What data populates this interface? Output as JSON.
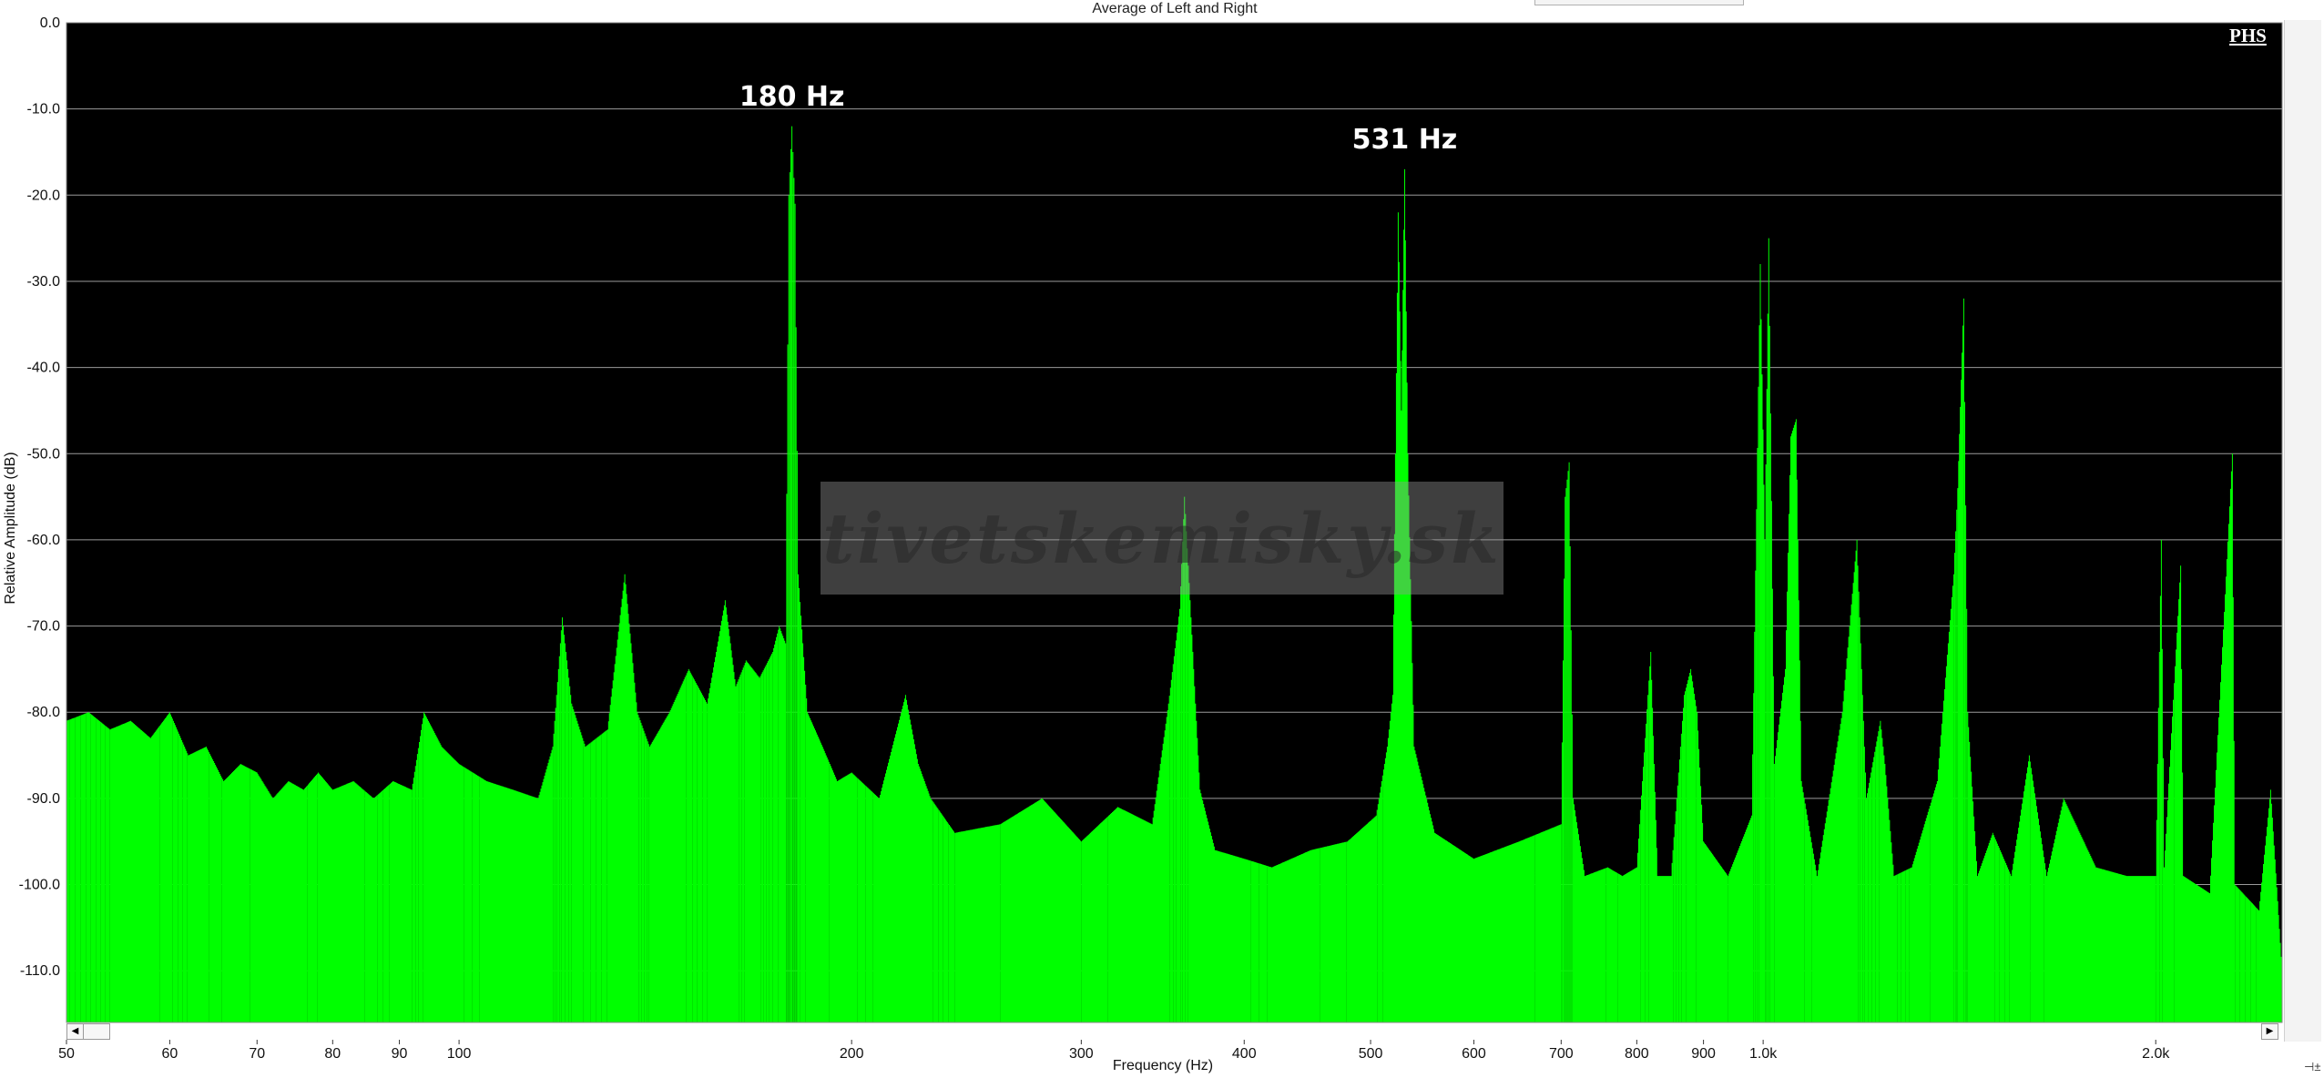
{
  "chart_data": {
    "type": "area",
    "title": "Average of Left and Right",
    "xlabel": "Frequency (Hz)",
    "ylabel": "Relative Amplitude (dB)",
    "x_scale": "log",
    "xlim": [
      50,
      2500
    ],
    "ylim": [
      -116,
      0
    ],
    "grid": "horizontal",
    "x_ticks": [
      "50",
      "60",
      "70",
      "80",
      "90",
      "100",
      "200",
      "300",
      "400",
      "500",
      "600",
      "700",
      "800",
      "900",
      "1.0k",
      "2.0k"
    ],
    "x_tick_values": [
      50,
      60,
      70,
      80,
      90,
      100,
      200,
      300,
      400,
      500,
      600,
      700,
      800,
      900,
      1000,
      2000
    ],
    "y_ticks": [
      "0.0",
      "-10.0",
      "-20.0",
      "-30.0",
      "-40.0",
      "-50.0",
      "-60.0",
      "-70.0",
      "-80.0",
      "-90.0",
      "-100.0",
      "-110.0"
    ],
    "y_tick_values": [
      0,
      -10,
      -20,
      -30,
      -40,
      -50,
      -60,
      -70,
      -80,
      -90,
      -100,
      -110
    ],
    "series": [
      {
        "color": "#00ff00",
        "floor_db": -116,
        "points": [
          [
            50,
            -81
          ],
          [
            52,
            -80
          ],
          [
            54,
            -82
          ],
          [
            56,
            -81
          ],
          [
            58,
            -83
          ],
          [
            60,
            -80
          ],
          [
            62,
            -85
          ],
          [
            64,
            -84
          ],
          [
            66,
            -88
          ],
          [
            68,
            -86
          ],
          [
            70,
            -87
          ],
          [
            72,
            -90
          ],
          [
            74,
            -88
          ],
          [
            76,
            -89
          ],
          [
            78,
            -87
          ],
          [
            80,
            -89
          ],
          [
            83,
            -88
          ],
          [
            86,
            -90
          ],
          [
            89,
            -88
          ],
          [
            92,
            -89
          ],
          [
            94,
            -80
          ],
          [
            97,
            -84
          ],
          [
            100,
            -86
          ],
          [
            105,
            -88
          ],
          [
            110,
            -89
          ],
          [
            115,
            -90
          ],
          [
            118,
            -84
          ],
          [
            120,
            -69
          ],
          [
            122,
            -79
          ],
          [
            125,
            -84
          ],
          [
            130,
            -82
          ],
          [
            134,
            -64
          ],
          [
            137,
            -80
          ],
          [
            140,
            -84
          ],
          [
            145,
            -80
          ],
          [
            150,
            -75
          ],
          [
            155,
            -79
          ],
          [
            160,
            -67
          ],
          [
            163,
            -77
          ],
          [
            166,
            -74
          ],
          [
            170,
            -76
          ],
          [
            174,
            -73
          ],
          [
            176,
            -70
          ],
          [
            178,
            -72
          ],
          [
            179,
            -20
          ],
          [
            180,
            -12
          ],
          [
            181,
            -21
          ],
          [
            182,
            -64
          ],
          [
            185,
            -80
          ],
          [
            190,
            -84
          ],
          [
            195,
            -88
          ],
          [
            200,
            -87
          ],
          [
            210,
            -90
          ],
          [
            220,
            -78
          ],
          [
            225,
            -86
          ],
          [
            230,
            -90
          ],
          [
            240,
            -94
          ],
          [
            260,
            -93
          ],
          [
            280,
            -90
          ],
          [
            300,
            -95
          ],
          [
            320,
            -91
          ],
          [
            340,
            -93
          ],
          [
            350,
            -79
          ],
          [
            357,
            -68
          ],
          [
            360,
            -55
          ],
          [
            363,
            -65
          ],
          [
            370,
            -89
          ],
          [
            380,
            -96
          ],
          [
            400,
            -97
          ],
          [
            420,
            -98
          ],
          [
            450,
            -96
          ],
          [
            480,
            -95
          ],
          [
            505,
            -92
          ],
          [
            515,
            -84
          ],
          [
            520,
            -78
          ],
          [
            525,
            -22
          ],
          [
            528,
            -45
          ],
          [
            531,
            -17
          ],
          [
            534,
            -50
          ],
          [
            540,
            -84
          ],
          [
            560,
            -94
          ],
          [
            600,
            -97
          ],
          [
            650,
            -95
          ],
          [
            700,
            -93
          ],
          [
            705,
            -55
          ],
          [
            710,
            -51
          ],
          [
            715,
            -90
          ],
          [
            730,
            -99
          ],
          [
            760,
            -98
          ],
          [
            780,
            -99
          ],
          [
            800,
            -98
          ],
          [
            820,
            -73
          ],
          [
            830,
            -99
          ],
          [
            850,
            -99
          ],
          [
            870,
            -78
          ],
          [
            880,
            -75
          ],
          [
            890,
            -80
          ],
          [
            900,
            -95
          ],
          [
            940,
            -99
          ],
          [
            980,
            -92
          ],
          [
            995,
            -28
          ],
          [
            1003,
            -60
          ],
          [
            1010,
            -25
          ],
          [
            1020,
            -86
          ],
          [
            1040,
            -75
          ],
          [
            1050,
            -48
          ],
          [
            1060,
            -46
          ],
          [
            1070,
            -88
          ],
          [
            1100,
            -99
          ],
          [
            1150,
            -80
          ],
          [
            1180,
            -60
          ],
          [
            1200,
            -90
          ],
          [
            1230,
            -81
          ],
          [
            1240,
            -86
          ],
          [
            1260,
            -99
          ],
          [
            1300,
            -98
          ],
          [
            1360,
            -88
          ],
          [
            1400,
            -64
          ],
          [
            1410,
            -54
          ],
          [
            1425,
            -32
          ],
          [
            1435,
            -80
          ],
          [
            1460,
            -99
          ],
          [
            1500,
            -94
          ],
          [
            1550,
            -99
          ],
          [
            1600,
            -85
          ],
          [
            1650,
            -99
          ],
          [
            1700,
            -90
          ],
          [
            1800,
            -98
          ],
          [
            1900,
            -99
          ],
          [
            2000,
            -99
          ],
          [
            2020,
            -60
          ],
          [
            2030,
            -98
          ],
          [
            2090,
            -63
          ],
          [
            2100,
            -99
          ],
          [
            2200,
            -101
          ],
          [
            2290,
            -50
          ],
          [
            2300,
            -100
          ],
          [
            2400,
            -103
          ],
          [
            2450,
            -89
          ],
          [
            2500,
            -110
          ]
        ]
      }
    ],
    "annotations": [
      {
        "text": "180 Hz",
        "x": 180,
        "y": -12
      },
      {
        "text": "531 Hz",
        "x": 531,
        "y": -17
      }
    ]
  },
  "watermark": "tivetskemisky.sk",
  "brand": "PHS",
  "colors": {
    "plot_background": "#000000",
    "series": "#00ff00",
    "gridline": "#9a9a9a"
  }
}
